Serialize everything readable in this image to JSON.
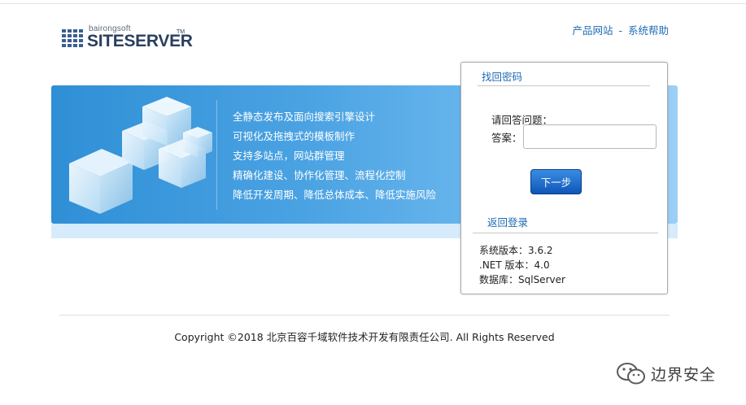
{
  "logo": {
    "small": "bairongsoft",
    "big": "SITESERVER",
    "tm": "TM"
  },
  "top_links": {
    "product_site": "产品网站",
    "separator": "-",
    "help": "系统帮助"
  },
  "banner": {
    "features": [
      "全静态发布及面向搜索引擎设计",
      "可视化及拖拽式的模板制作",
      "支持多站点，网站群管理",
      "精确化建设、协作化管理、流程化控制",
      "降低开发周期、降低总体成本、降低实施风险"
    ]
  },
  "panel": {
    "title": "找回密码",
    "question_label": "请回答问题：",
    "answer_label": "答案：",
    "answer_value": "",
    "next_button": "下一步",
    "back_link": "返回登录",
    "info": {
      "version": "系统版本：3.6.2",
      "net": ".NET 版本：4.0",
      "db": "数据库：SqlServer"
    }
  },
  "footer": {
    "copyright": "Copyright ©2018 北京百容千域软件技术开发有限责任公司. All Rights Reserved"
  },
  "watermark": {
    "text": "边界安全"
  },
  "colors": {
    "link": "#1f6bb5",
    "banner_start": "#2f8fd6",
    "banner_end": "#9ccff5",
    "button": "#0f56b8"
  }
}
